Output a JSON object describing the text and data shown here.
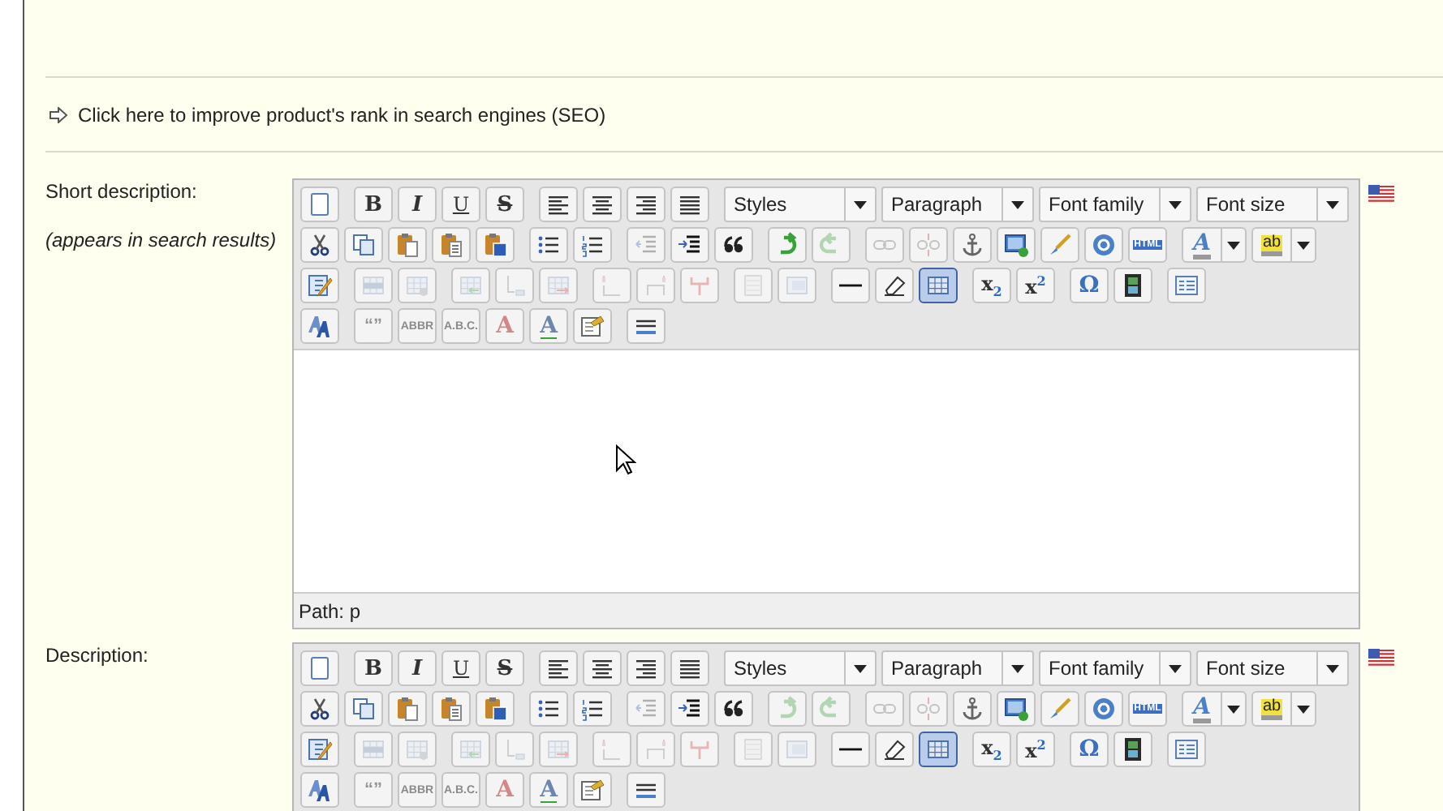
{
  "seo_link": {
    "text": "Click here to improve product's rank in search engines (SEO)"
  },
  "fields": [
    {
      "label": "Short description:",
      "hint": "(appears in search results)",
      "editor": {
        "path": "Path: p",
        "rows": [
          [
            [
              {
                "kind": "button",
                "disabled": false,
                "on": false
              }
            ],
            [
              {
                "kind": "button",
                "glyph": "B",
                "disabled": false,
                "on": false
              },
              {
                "kind": "button",
                "glyph": "I",
                "disabled": false,
                "on": false
              },
              {
                "kind": "button",
                "glyph": "U",
                "disabled": false,
                "on": false
              },
              {
                "kind": "button",
                "glyph": "S",
                "disabled": false,
                "on": false
              }
            ],
            [
              {
                "kind": "button",
                "disabled": false,
                "on": false
              },
              {
                "kind": "button",
                "disabled": false,
                "on": false
              },
              {
                "kind": "button",
                "disabled": false,
                "on": false
              },
              {
                "kind": "button",
                "disabled": false,
                "on": false
              }
            ],
            [
              {
                "kind": "select",
                "label": "Styles"
              },
              {
                "kind": "select",
                "label": "Paragraph"
              },
              {
                "kind": "select",
                "label": "Font family"
              },
              {
                "kind": "select",
                "label": "Font size"
              }
            ]
          ],
          [
            [
              {
                "kind": "button",
                "disabled": false,
                "on": false
              },
              {
                "kind": "button",
                "disabled": false,
                "on": false
              },
              {
                "kind": "button",
                "disabled": false,
                "on": false
              },
              {
                "kind": "button",
                "disabled": false,
                "on": false
              },
              {
                "kind": "button",
                "disabled": false,
                "on": false
              }
            ],
            [
              {
                "kind": "button",
                "disabled": false,
                "on": false
              },
              {
                "kind": "button",
                "disabled": false,
                "on": false
              }
            ],
            [
              {
                "kind": "button",
                "disabled": true,
                "on": false
              },
              {
                "kind": "button",
                "disabled": false,
                "on": false
              },
              {
                "kind": "button",
                "disabled": false,
                "on": false
              }
            ],
            [
              {
                "kind": "button",
                "disabled": false,
                "on": false
              },
              {
                "kind": "button",
                "disabled": true,
                "on": false
              }
            ],
            [
              {
                "kind": "button",
                "disabled": true,
                "on": false
              },
              {
                "kind": "button",
                "disabled": true,
                "on": false
              },
              {
                "kind": "button",
                "disabled": false,
                "on": false
              },
              {
                "kind": "button",
                "disabled": false,
                "on": false
              },
              {
                "kind": "button",
                "disabled": false,
                "on": false
              },
              {
                "kind": "button",
                "disabled": false,
                "on": false
              },
              {
                "kind": "button",
                "glyph": "HTML",
                "disabled": false,
                "on": false
              }
            ],
            [
              {
                "kind": "split",
                "glyph": "A",
                "disabled": false,
                "on": false
              },
              {
                "kind": "split",
                "glyph": "ab",
                "disabled": false,
                "on": false
              }
            ]
          ],
          [
            [
              {
                "kind": "button",
                "disabled": false,
                "on": false
              }
            ],
            [
              {
                "kind": "button",
                "disabled": true,
                "on": false
              },
              {
                "kind": "button",
                "disabled": true,
                "on": false
              }
            ],
            [
              {
                "kind": "button",
                "disabled": true,
                "on": false
              },
              {
                "kind": "button",
                "disabled": true,
                "on": false
              },
              {
                "kind": "button",
                "disabled": true,
                "on": false
              }
            ],
            [
              {
                "kind": "button",
                "disabled": true,
                "on": false
              },
              {
                "kind": "button",
                "disabled": true,
                "on": false
              },
              {
                "kind": "button",
                "disabled": true,
                "on": false
              }
            ],
            [
              {
                "kind": "button",
                "disabled": true,
                "on": false
              },
              {
                "kind": "button",
                "disabled": true,
                "on": false
              }
            ],
            [
              {
                "kind": "button",
                "disabled": false,
                "on": false
              },
              {
                "kind": "button",
                "disabled": false,
                "on": false
              },
              {
                "kind": "button",
                "disabled": false,
                "on": true
              }
            ],
            [
              {
                "kind": "button",
                "glyph": "x$_{2}$",
                "disabled": false,
                "on": false
              },
              {
                "kind": "button",
                "glyph": "x$^{2}$",
                "disabled": false,
                "on": false
              }
            ],
            [
              {
                "kind": "button",
                "glyph": "Ω",
                "disabled": false,
                "on": false
              },
              {
                "kind": "button",
                "disabled": false,
                "on": false
              }
            ],
            [
              {
                "kind": "button",
                "disabled": false,
                "on": false
              }
            ]
          ],
          [
            [
              {
                "kind": "button",
                "disabled": false,
                "on": false
              }
            ],
            [
              {
                "kind": "button",
                "glyph": "“”",
                "disabled": true,
                "on": false
              },
              {
                "kind": "button",
                "glyph": "ABBR",
                "disabled": true,
                "on": false
              },
              {
                "kind": "button",
                "glyph": "A.B.C.",
                "disabled": true,
                "on": false
              },
              {
                "kind": "button",
                "glyph": "A",
                "disabled": true,
                "on": false
              },
              {
                "kind": "button",
                "glyph": "A",
                "disabled": false,
                "on": false
              },
              {
                "kind": "button",
                "disabled": false,
                "on": false
              }
            ],
            [
              {
                "kind": "button",
                "disabled": false,
                "on": false
              }
            ]
          ]
        ]
      }
    },
    {
      "label": "Description:",
      "editor": {
        "rows": [
          [
            [
              {
                "kind": "button",
                "disabled": false,
                "on": false
              }
            ],
            [
              {
                "kind": "button",
                "glyph": "B",
                "disabled": false,
                "on": false
              },
              {
                "kind": "button",
                "glyph": "I",
                "disabled": false,
                "on": false
              },
              {
                "kind": "button",
                "glyph": "U",
                "disabled": false,
                "on": false
              },
              {
                "kind": "button",
                "glyph": "S",
                "disabled": false,
                "on": false
              }
            ],
            [
              {
                "kind": "button",
                "disabled": false,
                "on": false
              },
              {
                "kind": "button",
                "disabled": false,
                "on": false
              },
              {
                "kind": "button",
                "disabled": false,
                "on": false
              },
              {
                "kind": "button",
                "disabled": false,
                "on": false
              }
            ],
            [
              {
                "kind": "select",
                "label": "Styles"
              },
              {
                "kind": "select",
                "label": "Paragraph"
              },
              {
                "kind": "select",
                "label": "Font family"
              },
              {
                "kind": "select",
                "label": "Font size"
              }
            ]
          ],
          [
            [
              {
                "kind": "button",
                "disabled": false,
                "on": false
              },
              {
                "kind": "button",
                "disabled": false,
                "on": false
              },
              {
                "kind": "button",
                "disabled": false,
                "on": false
              },
              {
                "kind": "button",
                "disabled": false,
                "on": false
              },
              {
                "kind": "button",
                "disabled": false,
                "on": false
              }
            ],
            [
              {
                "kind": "button",
                "disabled": false,
                "on": false
              },
              {
                "kind": "button",
                "disabled": false,
                "on": false
              }
            ],
            [
              {
                "kind": "button",
                "disabled": true,
                "on": false
              },
              {
                "kind": "button",
                "disabled": false,
                "on": false
              },
              {
                "kind": "button",
                "disabled": false,
                "on": false
              }
            ],
            [
              {
                "kind": "button",
                "disabled": true,
                "on": false
              },
              {
                "kind": "button",
                "disabled": true,
                "on": false
              }
            ],
            [
              {
                "kind": "button",
                "disabled": true,
                "on": false
              },
              {
                "kind": "button",
                "disabled": true,
                "on": false
              },
              {
                "kind": "button",
                "disabled": false,
                "on": false
              },
              {
                "kind": "button",
                "disabled": false,
                "on": false
              },
              {
                "kind": "button",
                "disabled": false,
                "on": false
              },
              {
                "kind": "button",
                "disabled": false,
                "on": false
              },
              {
                "kind": "button",
                "glyph": "HTML",
                "disabled": false,
                "on": false
              }
            ],
            [
              {
                "kind": "split",
                "glyph": "A",
                "disabled": false,
                "on": false
              },
              {
                "kind": "split",
                "glyph": "ab",
                "disabled": false,
                "on": false
              }
            ]
          ],
          [
            [
              {
                "kind": "button",
                "disabled": false,
                "on": false
              }
            ],
            [
              {
                "kind": "button",
                "disabled": true,
                "on": false
              },
              {
                "kind": "button",
                "disabled": true,
                "on": false
              }
            ],
            [
              {
                "kind": "button",
                "disabled": true,
                "on": false
              },
              {
                "kind": "button",
                "disabled": true,
                "on": false
              },
              {
                "kind": "button",
                "disabled": true,
                "on": false
              }
            ],
            [
              {
                "kind": "button",
                "disabled": true,
                "on": false
              },
              {
                "kind": "button",
                "disabled": true,
                "on": false
              },
              {
                "kind": "button",
                "disabled": true,
                "on": false
              }
            ],
            [
              {
                "kind": "button",
                "disabled": true,
                "on": false
              },
              {
                "kind": "button",
                "disabled": true,
                "on": false
              }
            ],
            [
              {
                "kind": "button",
                "disabled": false,
                "on": false
              },
              {
                "kind": "button",
                "disabled": false,
                "on": false
              },
              {
                "kind": "button",
                "disabled": false,
                "on": true
              }
            ],
            [
              {
                "kind": "button",
                "glyph": "x$_{2}$",
                "disabled": false,
                "on": false
              },
              {
                "kind": "button",
                "glyph": "x$^{2}$",
                "disabled": false,
                "on": false
              }
            ],
            [
              {
                "kind": "button",
                "glyph": "Ω",
                "disabled": false,
                "on": false
              },
              {
                "kind": "button",
                "disabled": false,
                "on": false
              }
            ],
            [
              {
                "kind": "button",
                "disabled": false,
                "on": false
              }
            ]
          ],
          [
            [
              {
                "kind": "button",
                "disabled": false,
                "on": false
              }
            ],
            [
              {
                "kind": "button",
                "glyph": "“”",
                "disabled": true,
                "on": false
              },
              {
                "kind": "button",
                "glyph": "ABBR",
                "disabled": true,
                "on": false
              },
              {
                "kind": "button",
                "glyph": "A.B.C.",
                "disabled": true,
                "on": false
              },
              {
                "kind": "button",
                "glyph": "A",
                "disabled": true,
                "on": false
              },
              {
                "kind": "button",
                "glyph": "A",
                "disabled": false,
                "on": false
              },
              {
                "kind": "button",
                "disabled": false,
                "on": false
              }
            ],
            [
              {
                "kind": "button",
                "disabled": false,
                "on": false
              }
            ]
          ]
        ]
      }
    }
  ]
}
